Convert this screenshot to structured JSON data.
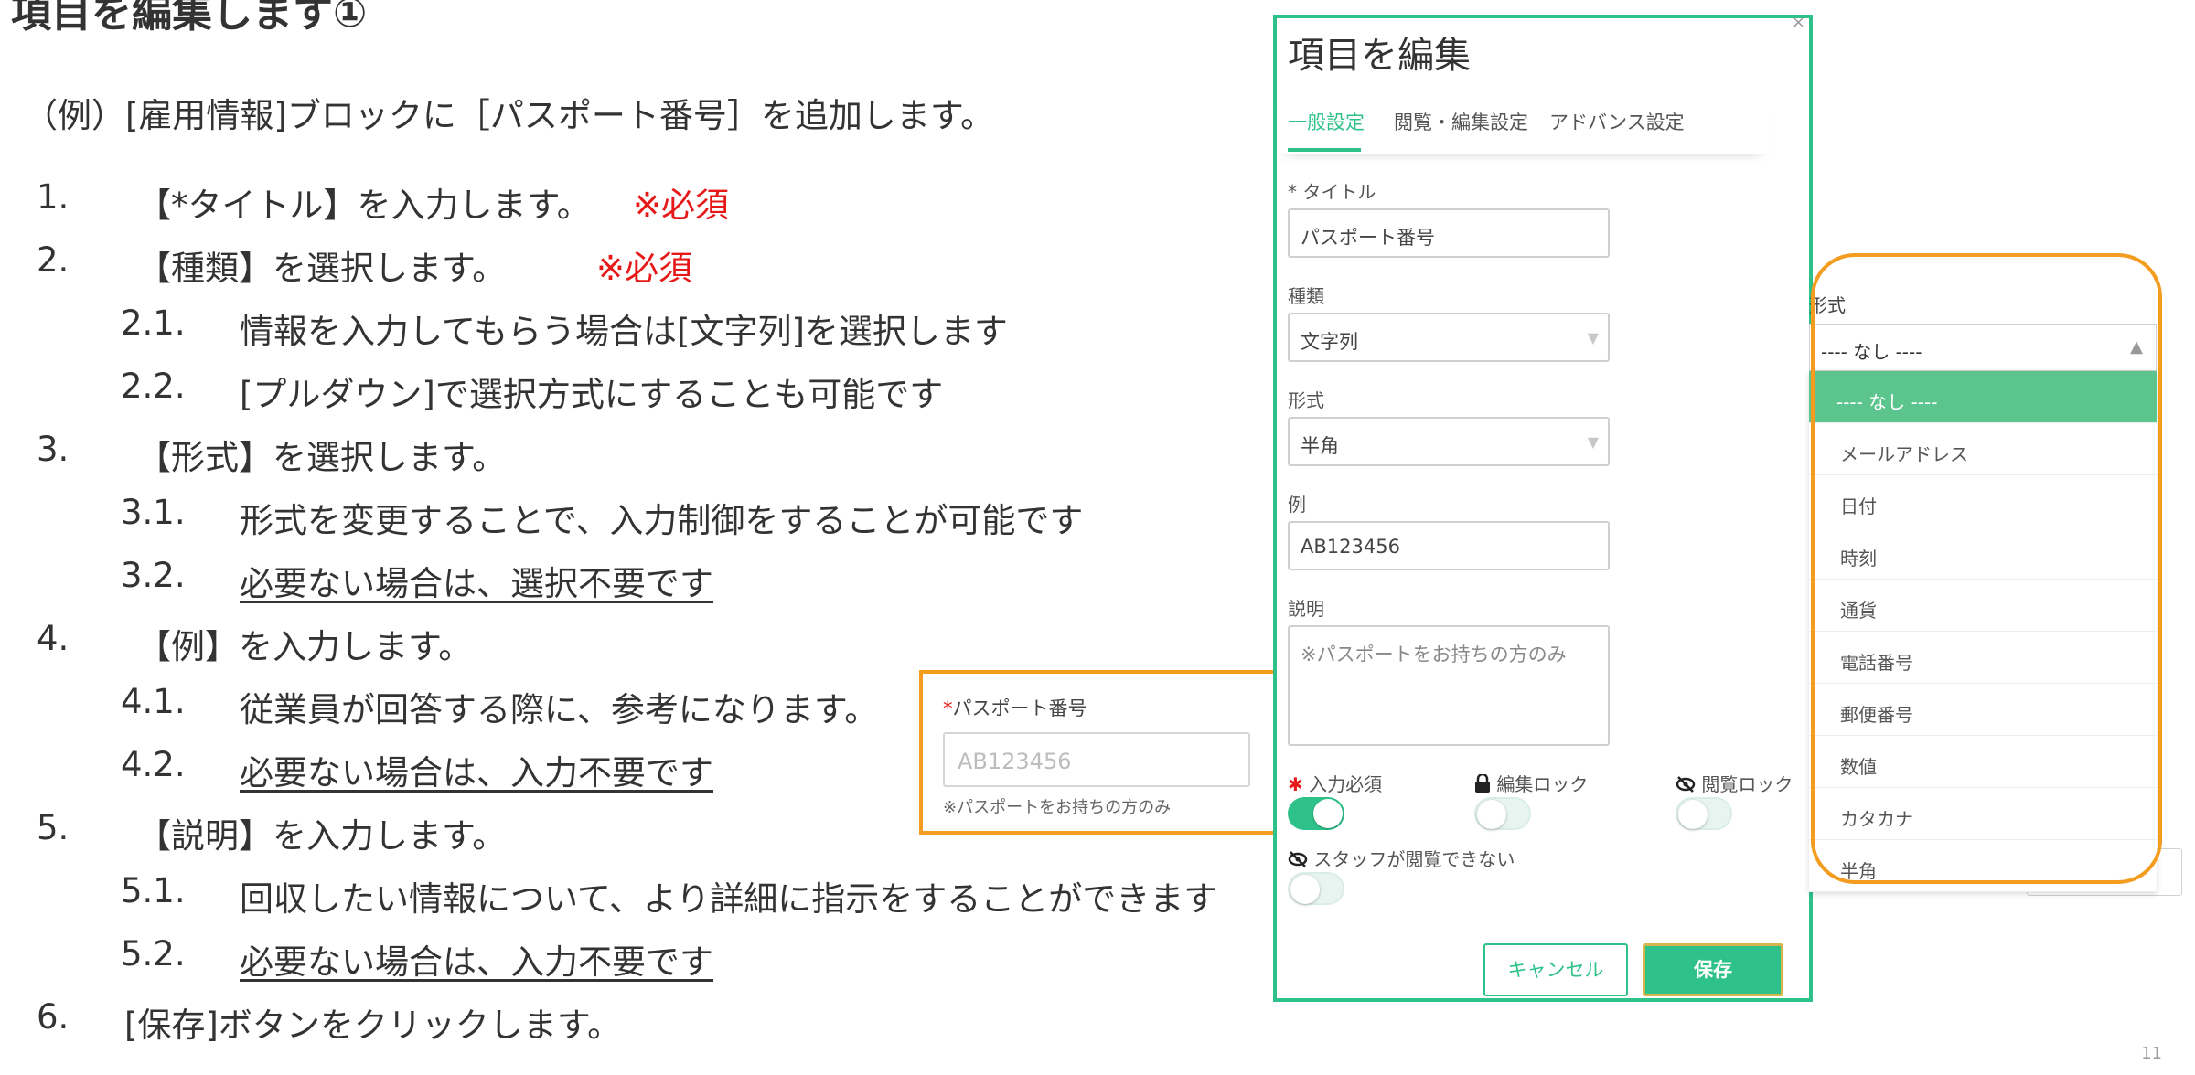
{
  "slide": {
    "title": "項目を編集します①",
    "intro": "（例）[雇用情報]ブロックに［パスポート番号］を追加します。",
    "page_number": "11",
    "required_mark": "※必須"
  },
  "steps": [
    {
      "num": "1.",
      "text": "【*タイトル】を入力します。",
      "required": true
    },
    {
      "num": "2.",
      "text": "【種類】を選択します。",
      "required": true
    },
    {
      "num": "2.1.",
      "text": "情報を入力してもらう場合は[文字列]を選択します"
    },
    {
      "num": "2.2.",
      "text": "[プルダウン]で選択方式にすることも可能です"
    },
    {
      "num": "3.",
      "text": "【形式】を選択します。"
    },
    {
      "num": "3.1.",
      "text": "形式を変更することで、入力制御をすることが可能です"
    },
    {
      "num": "3.2.",
      "text": "必要ない場合は、選択不要です",
      "underline": true
    },
    {
      "num": "4.",
      "text": "【例】を入力します。"
    },
    {
      "num": "4.1.",
      "text": "従業員が回答する際に、参考になります。"
    },
    {
      "num": "4.2.",
      "text": "必要ない場合は、入力不要です",
      "underline": true
    },
    {
      "num": "5.",
      "text": "【説明】を入力します。"
    },
    {
      "num": "5.1.",
      "text": "回収したい情報について、より詳細に指示をすることができます"
    },
    {
      "num": "5.2.",
      "text": "必要ない場合は、入力不要です",
      "underline": true
    },
    {
      "num": "6.",
      "text": "[保存]ボタンをクリックします。"
    }
  ],
  "preview": {
    "label": "パスポート番号",
    "required_star": "*",
    "placeholder": "AB123456",
    "hint": "※パスポートをお持ちの方のみ"
  },
  "dialog": {
    "title": "項目を編集",
    "close_glyph": "×",
    "tabs": [
      {
        "label": "一般設定",
        "active": true
      },
      {
        "label": "閲覧・編集設定",
        "active": false
      },
      {
        "label": "アドバンス設定",
        "active": false
      }
    ],
    "fields": {
      "title_label": "* タイトル",
      "title_value": "パスポート番号",
      "type_label": "種類",
      "type_value": "文字列",
      "format_label": "形式",
      "format_value": "半角",
      "example_label": "例",
      "example_value": "AB123456",
      "description_label": "説明",
      "description_value": "※パスポートをお持ちの方のみ"
    },
    "toggles": [
      {
        "label": "入力必須",
        "icon": "asterisk-icon",
        "on": true
      },
      {
        "label": "編集ロック",
        "icon": "lock-icon",
        "on": false
      },
      {
        "label": "閲覧ロック",
        "icon": "eye-slash-icon",
        "on": false
      },
      {
        "label": "スタッフが閲覧できない",
        "icon": "eye-slash-icon",
        "on": false
      }
    ],
    "cancel_label": "キャンセル",
    "save_label": "保存"
  },
  "dropdown": {
    "label": "形式",
    "selected": "---- なし ----",
    "options": [
      "---- なし ----",
      "メールアドレス",
      "日付",
      "時刻",
      "通貨",
      "電話番号",
      "郵便番号",
      "数値",
      "カタカナ",
      "半角"
    ]
  },
  "colors": {
    "accent_green": "#2ec28a",
    "highlight_orange": "#f39c1f",
    "required_red": "#e61919"
  }
}
